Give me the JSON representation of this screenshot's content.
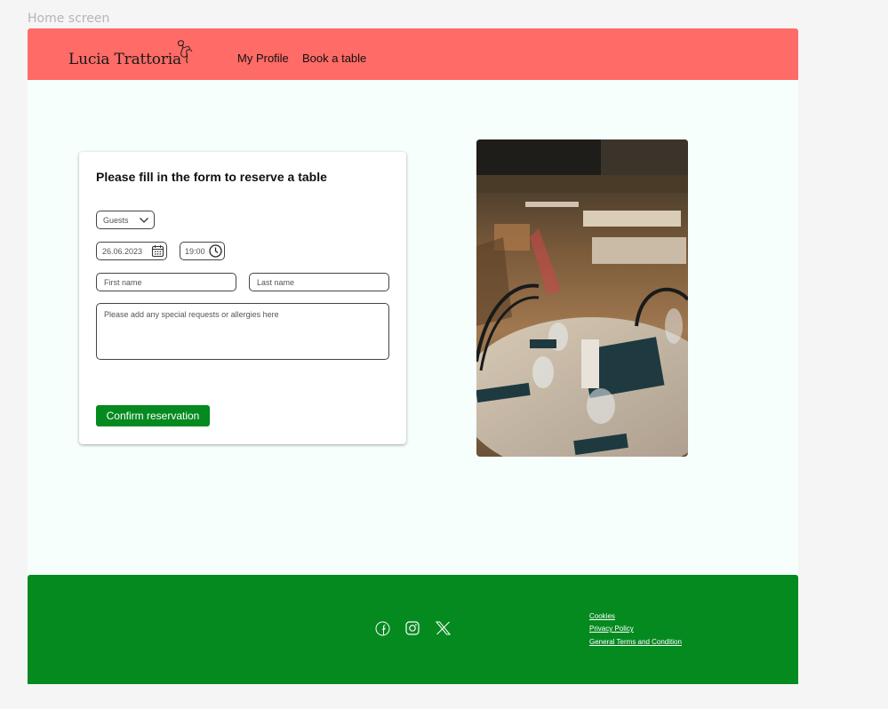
{
  "frame": {
    "label": "Home screen"
  },
  "header": {
    "logo_text": "Lucia Trattoria",
    "nav": [
      {
        "label": "My Profile"
      },
      {
        "label": "Book a table"
      }
    ]
  },
  "form": {
    "title": "Please fill in the form to reserve a table",
    "guests": {
      "value": "Guests",
      "icon": "chevron-down-icon"
    },
    "date": {
      "value": "26.06.2023",
      "icon": "calendar-icon"
    },
    "time": {
      "value": "19:00",
      "icon": "clock-icon"
    },
    "first_name": {
      "placeholder": "First name"
    },
    "last_name": {
      "placeholder": "Last name"
    },
    "notes": {
      "placeholder": "Please add any special requests or allergies here"
    },
    "confirm_label": "Confirm reservation"
  },
  "footer": {
    "social": [
      "facebook-icon",
      "instagram-icon",
      "x-icon"
    ],
    "links": [
      {
        "label": "Cookies"
      },
      {
        "label": "Privacy Policy"
      },
      {
        "label": "General Terms and Condition"
      }
    ]
  },
  "colors": {
    "header_bg": "#ff6b66",
    "page_bg": "#f6fffb",
    "accent_green": "#058a20"
  }
}
